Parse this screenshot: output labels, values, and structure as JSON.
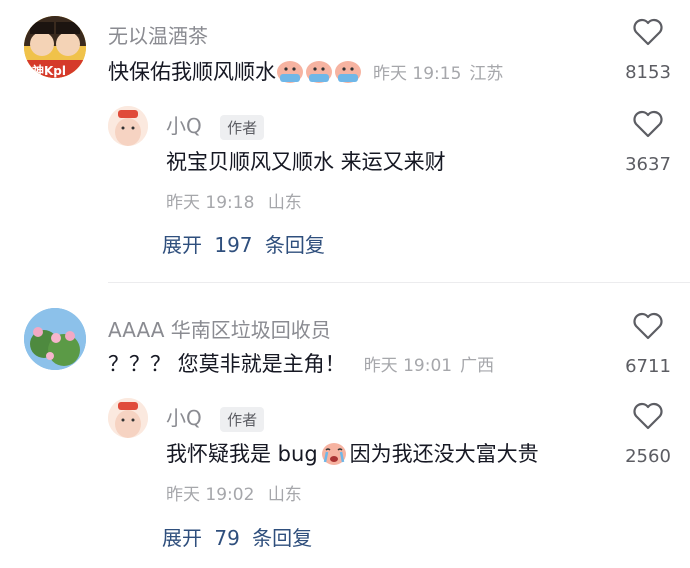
{
  "comments": [
    {
      "username": "无以温酒茶",
      "text": "快保佑我顺风顺水",
      "emoji_icons": [
        "praying-emoji",
        "praying-emoji",
        "praying-emoji"
      ],
      "time": "昨天 19:15",
      "location": "江苏",
      "likes": "8153",
      "avatar_text": "神Kpl",
      "reply": {
        "username": "小Q",
        "badge": "作者",
        "text": "祝宝贝顺风又顺水 来运又来财",
        "time": "昨天 19:18",
        "location": "山东",
        "likes": "3637"
      },
      "expand_label": "展开",
      "expand_count": "197",
      "expand_suffix": "条回复"
    },
    {
      "username": "AAAA 华南区垃圾回收员",
      "text": "？？？ 您莫非就是主角！",
      "time": "昨天 19:01",
      "location": "广西",
      "likes": "6711",
      "reply": {
        "username": "小Q",
        "badge": "作者",
        "text_before": "我怀疑我是 bug",
        "emoji_icon": "crying-emoji",
        "text_after": "因为我还没大富大贵",
        "time": "昨天 19:02",
        "location": "山东",
        "likes": "2560"
      },
      "expand_label": "展开",
      "expand_count": "79",
      "expand_suffix": "条回复"
    }
  ],
  "colors": {
    "username": "#8a8b91",
    "text": "#161823",
    "meta": "#a6a7ab",
    "expand": "#2f4f7d"
  }
}
